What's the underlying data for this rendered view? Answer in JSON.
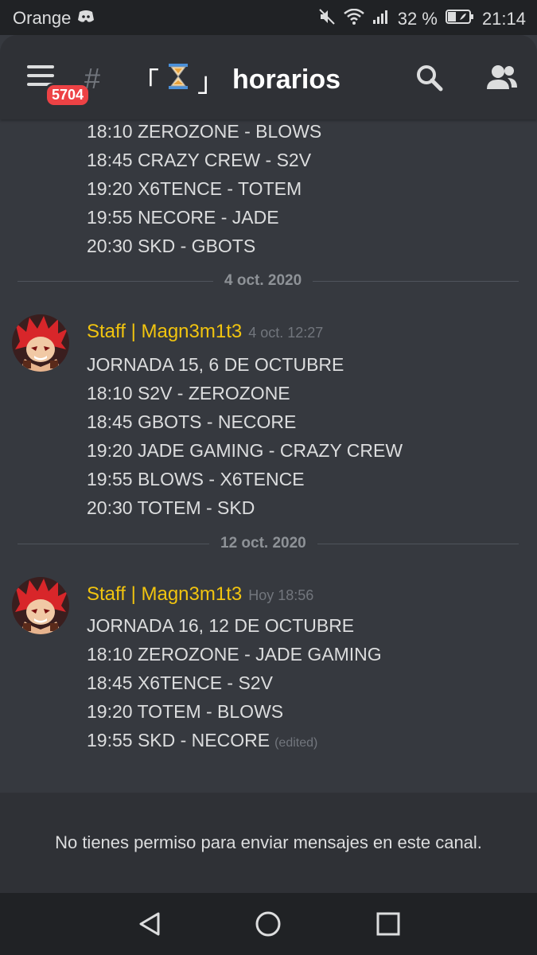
{
  "status_bar": {
    "carrier": "Orange",
    "battery": "32 %",
    "time": "21:14",
    "icons": [
      "discord-icon",
      "mute-icon",
      "wifi-icon",
      "signal-icon",
      "battery-icon"
    ]
  },
  "header": {
    "unread_badge": "5704",
    "channel_prefix": "#",
    "bracket_open": "「",
    "bracket_close": "」",
    "channel_name": "horarios",
    "icons": [
      "menu-icon",
      "hourglass-icon",
      "search-icon",
      "members-icon"
    ]
  },
  "messages": {
    "previous_lines": [
      "18:10 ZEROZONE - BLOWS",
      "18:45 CRAZY CREW - S2V",
      "19:20 X6TENCE - TOTEM",
      "19:55 NECORE - JADE",
      "20:30 SKD - GBOTS"
    ],
    "groups": [
      {
        "date": "4 oct. 2020",
        "author": "Staff | Magn3m1t3",
        "timestamp": "4 oct. 12:27",
        "lines": [
          "JORNADA 15, 6 DE OCTUBRE",
          "18:10 S2V - ZEROZONE",
          "18:45 GBOTS - NECORE",
          "19:20 JADE GAMING - CRAZY CREW",
          "19:55 BLOWS - X6TENCE",
          "20:30 TOTEM - SKD"
        ]
      },
      {
        "date": "12 oct. 2020",
        "author": "Staff | Magn3m1t3",
        "timestamp": "Hoy 18:56",
        "lines": [
          "JORNADA 16, 12 DE OCTUBRE",
          "18:10 ZEROZONE - JADE GAMING",
          "18:45 X6TENCE - S2V",
          "19:20 TOTEM - BLOWS",
          "19:55 SKD - NECORE"
        ],
        "edited_label": "(edited)"
      }
    ]
  },
  "footer": {
    "no_permission": "No tienes permiso para enviar mensajes en este canal."
  },
  "nav_bar": {
    "icons": [
      "back-icon",
      "home-icon",
      "recents-icon"
    ]
  },
  "colors": {
    "background": "#36393f",
    "header": "#2f3136",
    "author": "#f1c40f",
    "badge": "#ed4245"
  }
}
